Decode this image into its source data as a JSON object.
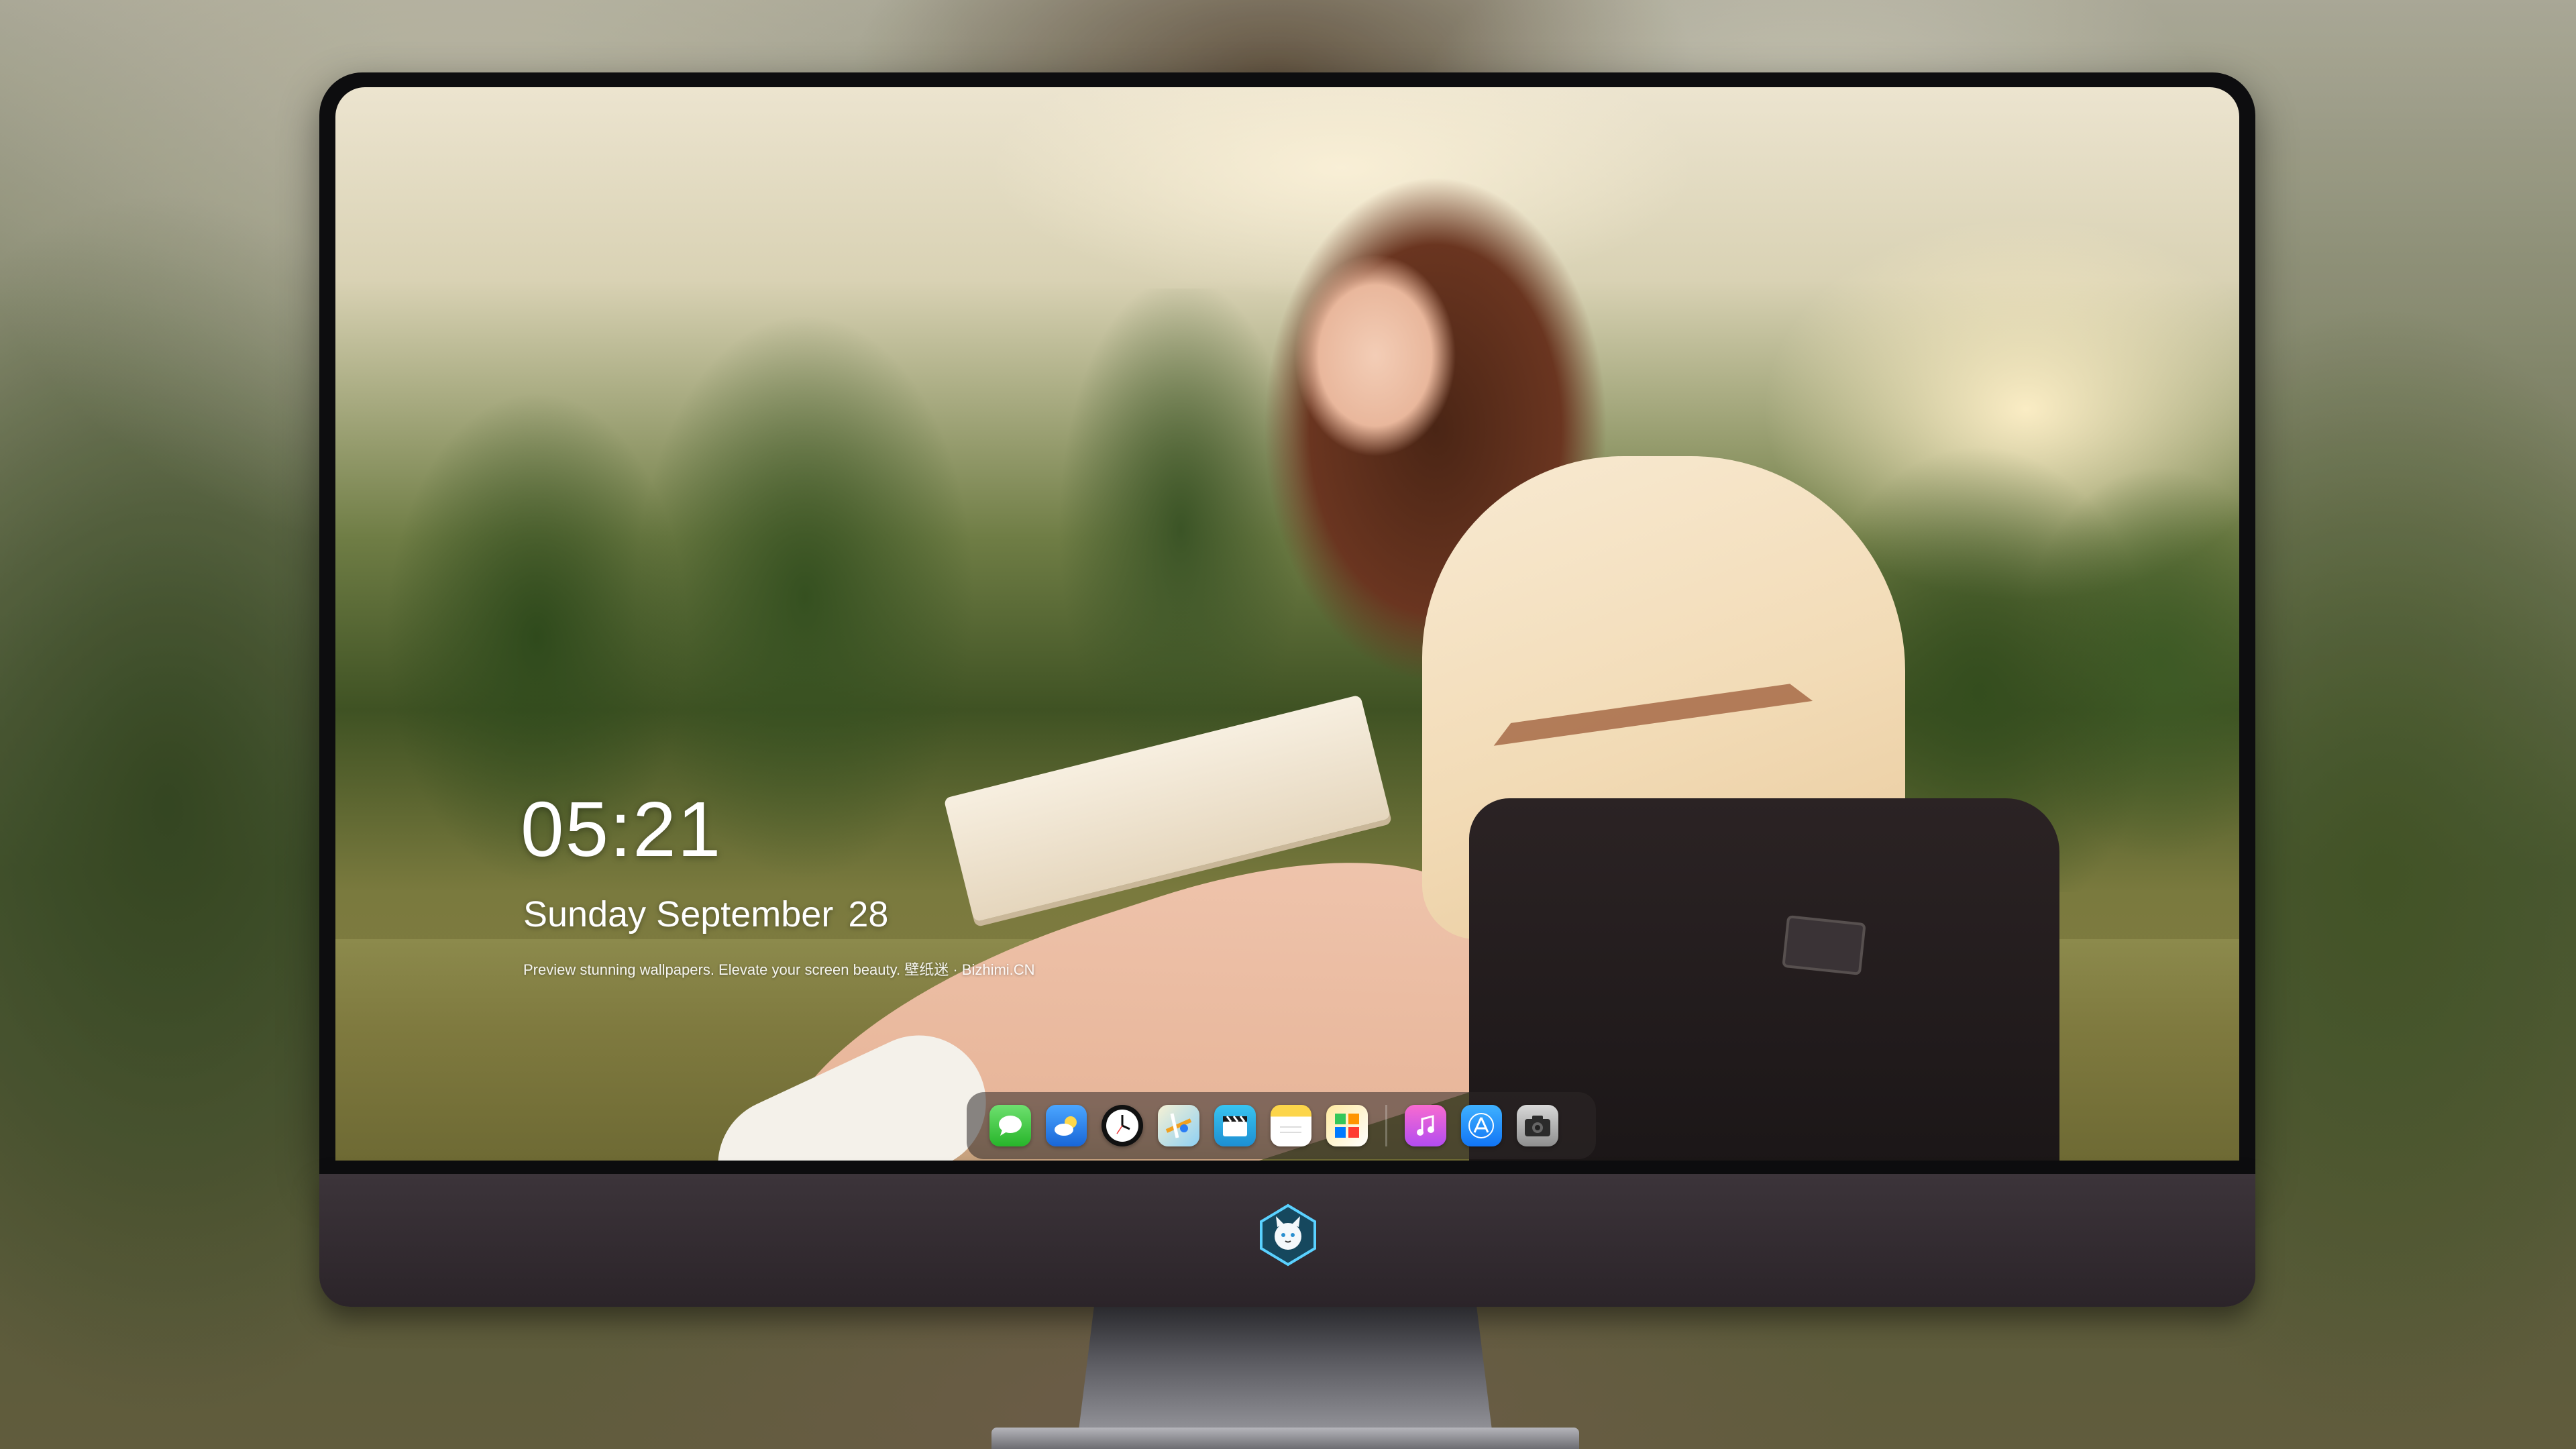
{
  "lock_screen": {
    "time": "05:21",
    "weekday": "Sunday",
    "month": "September",
    "day": "28",
    "tagline": "Preview stunning wallpapers. Elevate your screen beauty. 壁纸迷 · Bizhimi.CN"
  },
  "dock": {
    "apps": [
      {
        "name": "Messages",
        "icon": "messages-icon"
      },
      {
        "name": "Weather",
        "icon": "weather-icon"
      },
      {
        "name": "Clock",
        "icon": "clock-icon"
      },
      {
        "name": "Maps",
        "icon": "maps-icon"
      },
      {
        "name": "Video",
        "icon": "video-icon"
      },
      {
        "name": "Notes",
        "icon": "notes-icon"
      },
      {
        "name": "Photos",
        "icon": "photos-icon"
      },
      {
        "name": "Music",
        "icon": "music-icon"
      },
      {
        "name": "App Store",
        "icon": "app-store-icon"
      },
      {
        "name": "Camera",
        "icon": "camera-icon"
      }
    ]
  },
  "monitor": {
    "logo_icon": "cat-shield-logo-icon"
  },
  "colors": {
    "bezel": "#0d0d0f",
    "chin": "#3c343a",
    "dock_bg": "rgba(45,40,40,0.55)",
    "text": "#ffffff"
  }
}
